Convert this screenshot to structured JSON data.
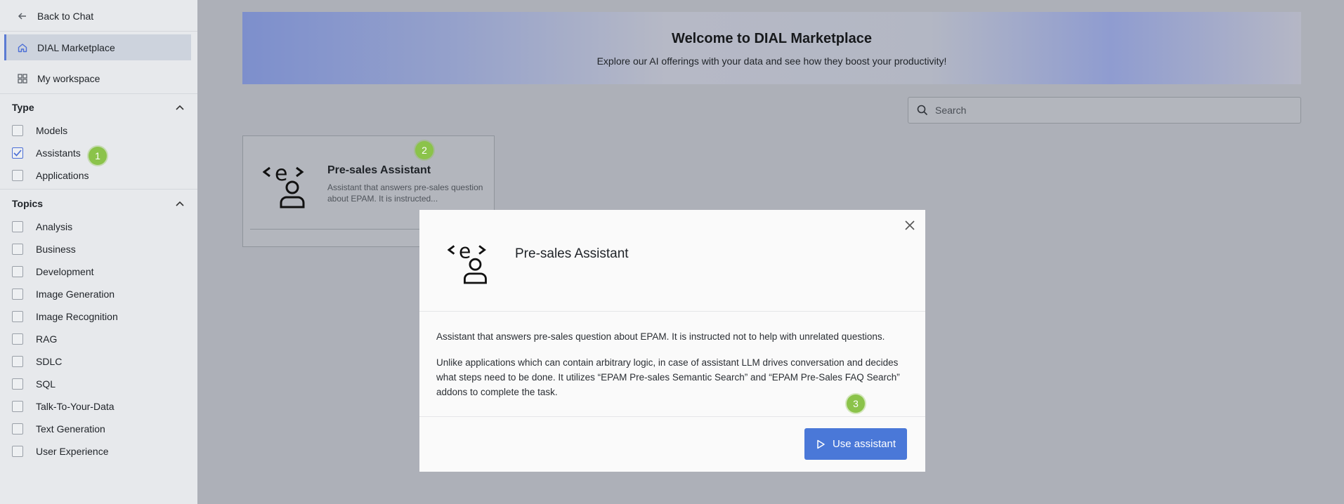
{
  "sidebar": {
    "back_label": "Back to Chat",
    "nav": [
      {
        "label": "DIAL Marketplace",
        "icon": "home-icon",
        "active": true
      },
      {
        "label": "My workspace",
        "icon": "grid-icon",
        "active": false
      }
    ],
    "type_section": {
      "title": "Type",
      "items": [
        {
          "label": "Models",
          "checked": false
        },
        {
          "label": "Assistants",
          "checked": true
        },
        {
          "label": "Applications",
          "checked": false
        }
      ]
    },
    "topics_section": {
      "title": "Topics",
      "items": [
        {
          "label": "Analysis"
        },
        {
          "label": "Business"
        },
        {
          "label": "Development"
        },
        {
          "label": "Image Generation"
        },
        {
          "label": "Image Recognition"
        },
        {
          "label": "RAG"
        },
        {
          "label": "SDLC"
        },
        {
          "label": "SQL"
        },
        {
          "label": "Talk-To-Your-Data"
        },
        {
          "label": "Text Generation"
        },
        {
          "label": "User Experience"
        }
      ]
    }
  },
  "banner": {
    "title": "Welcome to DIAL Marketplace",
    "subtitle": "Explore our AI offerings with your data and see how they boost your productivity!"
  },
  "search": {
    "placeholder": "Search"
  },
  "card": {
    "title": "Pre-sales Assistant",
    "description": "Assistant that answers pre-sales question about EPAM. It is instructed..."
  },
  "modal": {
    "title": "Pre-sales Assistant",
    "paragraph1": "Assistant that answers pre-sales question about EPAM. It is instructed not to help with unrelated questions.",
    "paragraph2": "Unlike applications which can contain arbitrary logic, in case of assistant LLM drives conversation and decides what steps need to be done. It utilizes “EPAM Pre-sales Semantic Search” and “EPAM Pre-Sales FAQ Search” addons to complete the task.",
    "button_label": "Use assistant"
  },
  "badges": [
    "1",
    "2",
    "3"
  ],
  "colors": {
    "accent": "#4a78d8",
    "badge": "#8bc34a"
  }
}
